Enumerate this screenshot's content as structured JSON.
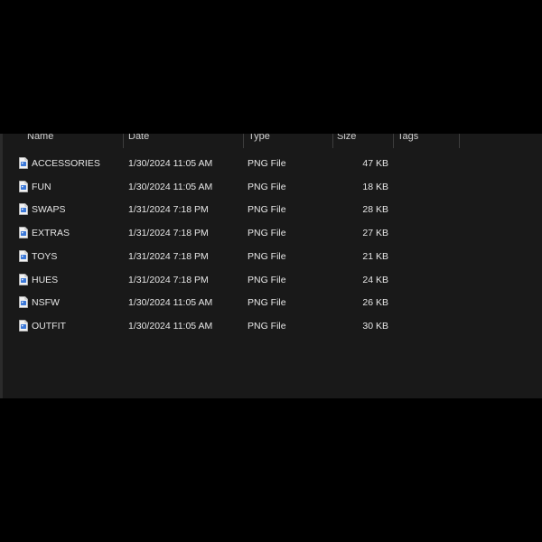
{
  "header": {
    "columns": [
      "Name",
      "Date",
      "Type",
      "Size",
      "Tags"
    ]
  },
  "files": [
    {
      "name": "ACCESSORIES",
      "date": "1/30/2024 11:05 AM",
      "type": "PNG File",
      "size": "47 KB"
    },
    {
      "name": "FUN",
      "date": "1/30/2024 11:05 AM",
      "type": "PNG File",
      "size": "18 KB"
    },
    {
      "name": "SWAPS",
      "date": "1/31/2024 7:18 PM",
      "type": "PNG File",
      "size": "28 KB"
    },
    {
      "name": "EXTRAS",
      "date": "1/31/2024 7:18 PM",
      "type": "PNG File",
      "size": "27 KB"
    },
    {
      "name": "TOYS",
      "date": "1/31/2024 7:18 PM",
      "type": "PNG File",
      "size": "21 KB"
    },
    {
      "name": "HUES",
      "date": "1/31/2024 7:18 PM",
      "type": "PNG File",
      "size": "24 KB"
    },
    {
      "name": "NSFW",
      "date": "1/30/2024 11:05 AM",
      "type": "PNG File",
      "size": "26 KB"
    },
    {
      "name": "OUTFIT",
      "date": "1/30/2024 11:05 AM",
      "type": "PNG File",
      "size": "30 KB"
    }
  ],
  "icons": {
    "file": "png-file-icon"
  },
  "colors": {
    "background": "#191919",
    "text": "#e6e6e6",
    "icon_accent": "#3b78d8"
  }
}
